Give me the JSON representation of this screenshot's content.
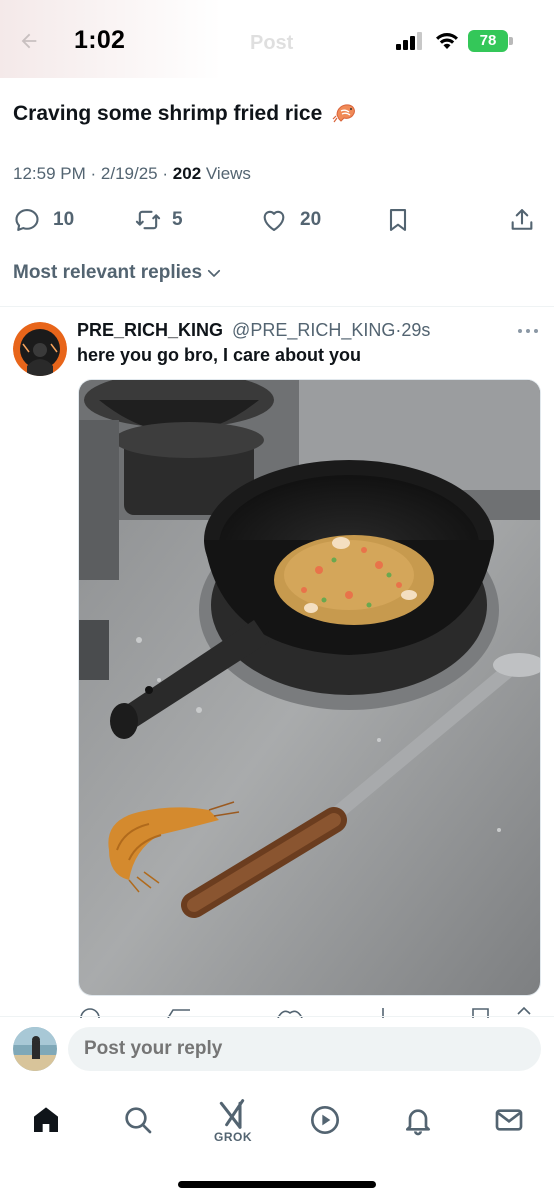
{
  "status_bar": {
    "time": "1:02",
    "battery": "78",
    "faded_title": "Post"
  },
  "post": {
    "text": "Craving some shrimp fried rice",
    "emoji": "shrimp-emoji",
    "time": "12:59 PM",
    "date": "2/19/25",
    "views_count": "202",
    "views_label": "Views",
    "replies": "10",
    "reposts": "5",
    "likes": "20"
  },
  "sort": {
    "label": "Most relevant replies"
  },
  "reply": {
    "name": "PRE_RICH_KING",
    "handle": "@PRE_RICH_KING",
    "age": "29s",
    "text": "here you go bro, I care about you"
  },
  "composer": {
    "placeholder": "Post your reply"
  },
  "nav": {
    "grok_label": "GROK"
  },
  "colors": {
    "accent": "#1d9bf0",
    "muted": "#536471",
    "battery": "#34c759"
  }
}
